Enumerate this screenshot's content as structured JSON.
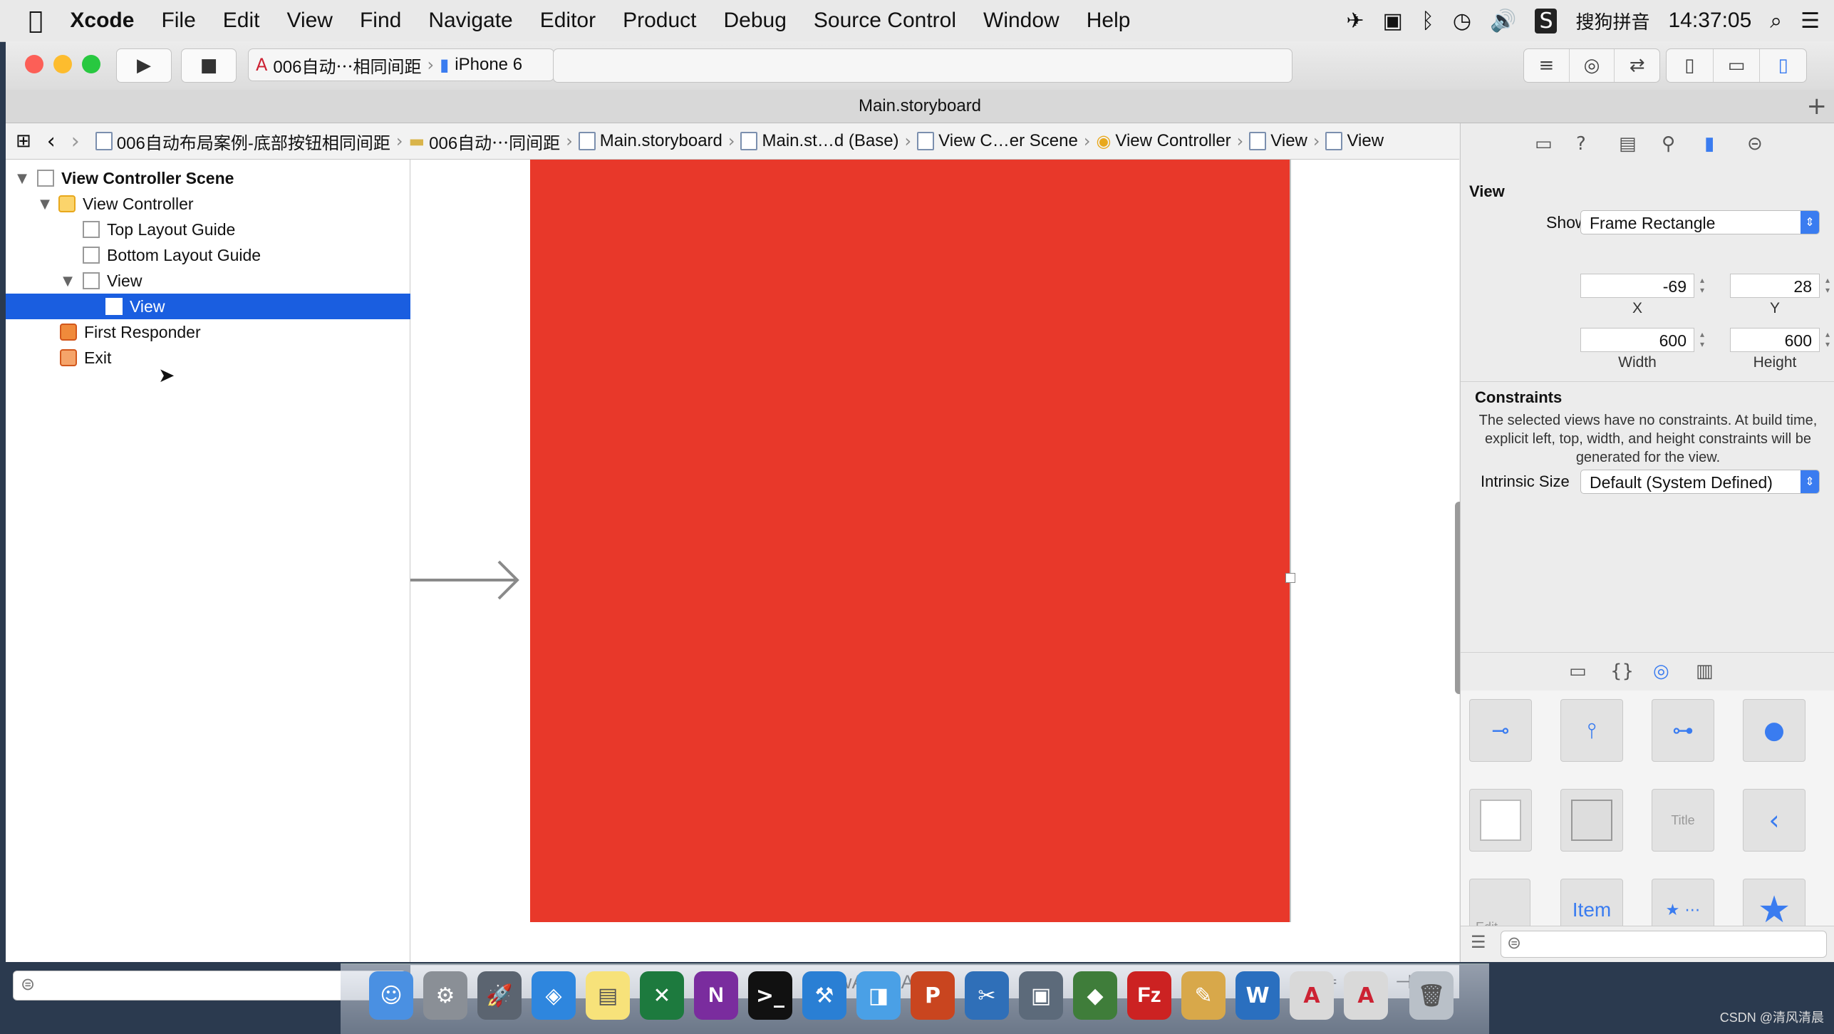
{
  "menubar": {
    "apple": "",
    "app": "Xcode",
    "items": [
      "File",
      "Edit",
      "View",
      "Find",
      "Navigate",
      "Editor",
      "Product",
      "Debug",
      "Source Control",
      "Window",
      "Help"
    ],
    "input_method": "搜狗拼音",
    "clock": "14:37:05"
  },
  "toolbar": {
    "scheme": "006自动⋯相同间距",
    "device": "iPhone 6"
  },
  "tab": {
    "title": "Main.storyboard"
  },
  "jumpbar": [
    "006自动布局案例-底部按钮相同间距",
    "006自动⋯同间距",
    "Main.storyboard",
    "Main.st…d (Base)",
    "View C…er Scene",
    "View Controller",
    "View",
    "View"
  ],
  "navigator": {
    "items": [
      {
        "label": "View Controller Scene"
      },
      {
        "label": "View Controller"
      },
      {
        "label": "Top Layout Guide"
      },
      {
        "label": "Bottom Layout Guide"
      },
      {
        "label": "View"
      },
      {
        "label": "View"
      },
      {
        "label": "First Responder"
      },
      {
        "label": "Exit"
      }
    ]
  },
  "canvas": {
    "view_color": "#e8382a",
    "size_class": "wAny hAny"
  },
  "inspector": {
    "title": "View",
    "show_label": "Show",
    "show_value": "Frame Rectangle",
    "x": "-69",
    "y": "28",
    "x_label": "X",
    "y_label": "Y",
    "width": "600",
    "height": "600",
    "width_label": "Width",
    "height_label": "Height",
    "constraints_title": "Constraints",
    "constraints_text": "The selected views have no constraints. At build time, explicit left, top, width, and height constraints will be generated for the view.",
    "intrinsic_label": "Intrinsic Size",
    "intrinsic_value": "Default (System Defined)"
  },
  "library": {
    "labels": {
      "title_cell": "Title",
      "item_cell": "Item",
      "edit_cell": "Edit"
    }
  },
  "dock": {
    "onenote": "N",
    "filezilla": "Fz"
  },
  "watermark": "CSDN @清风清晨"
}
